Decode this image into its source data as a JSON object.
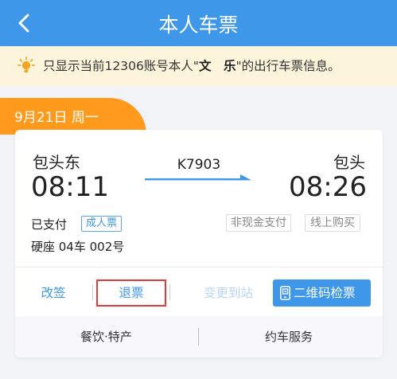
{
  "header": {
    "title": "本人车票",
    "back_icon": "back-arrow-icon"
  },
  "notice": {
    "icon": "bulb-icon",
    "text_before": "只显示当前12306账号本人\"",
    "name": "文　乐",
    "text_after": "\"的出行车票信息。"
  },
  "date": {
    "label": "9月21日 周一"
  },
  "ticket": {
    "from_station": "包头东",
    "to_station": "包头",
    "depart_time": "08:11",
    "arrive_time": "08:26",
    "train_no": "K7903",
    "payment_status": "已支付",
    "ticket_type": "成人票",
    "noncash": "非现金支付",
    "online": "线上购买",
    "seat": "硬座 04车 002号"
  },
  "actions": {
    "change": "改签",
    "refund": "退票",
    "change_station": "变更到站",
    "qr": "二维码检票"
  },
  "services": {
    "food": "餐饮·特产",
    "car": "约车服务"
  },
  "colors": {
    "primary": "#3f97ea",
    "accent": "#ff9a1c",
    "notice_bg": "#fdf4dc",
    "highlight": "#e23a3a"
  }
}
